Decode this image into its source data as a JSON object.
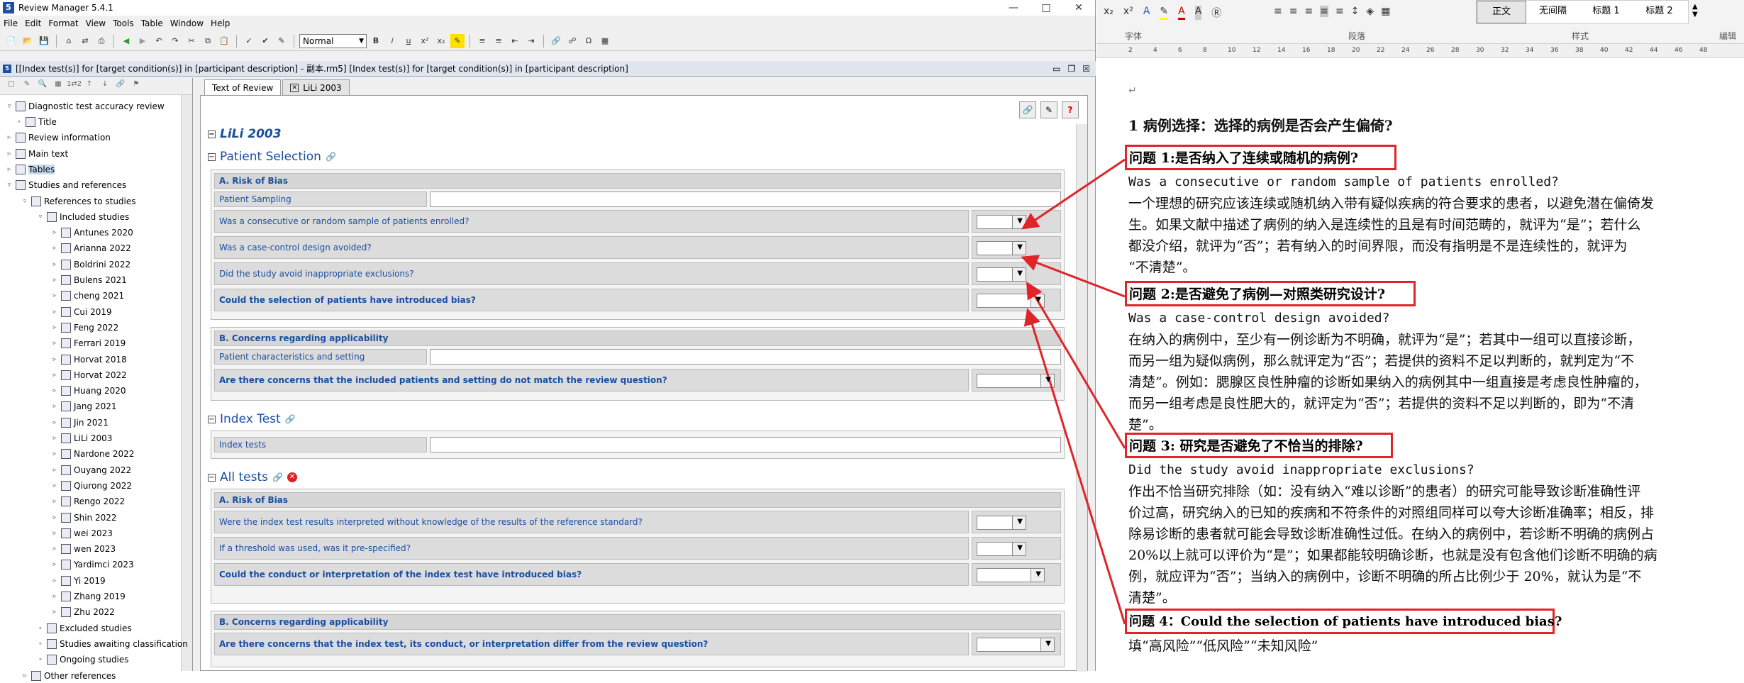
{
  "app": {
    "title": "Review Manager 5.4.1",
    "menu": [
      "File",
      "Edit",
      "Format",
      "View",
      "Tools",
      "Table",
      "Window",
      "Help"
    ],
    "style_select": "Normal",
    "doc_title": "[[Index test(s)] for [target condition(s)] in [participant description] - 副本.rm5] [Index test(s)] for [target condition(s)] in [participant description]"
  },
  "tree": {
    "root": "Diagnostic test accuracy review",
    "items": [
      "Title",
      "Review information",
      "Main text",
      "Tables",
      "Studies and references",
      "References to studies",
      "Included studies"
    ],
    "studies": [
      "Antunes 2020",
      "Arianna 2022",
      "Boldrini 2022",
      "Bulens 2021",
      "cheng 2021",
      "Cui 2019",
      "Feng 2022",
      "Ferrari 2019",
      "Horvat 2018",
      "Horvat 2022",
      "Huang 2020",
      "Jang 2021",
      "Jin 2021",
      "LiLi 2003",
      "Nardone 2022",
      "Ouyang 2022",
      "Qiurong 2022",
      "Rengo 2022",
      "Shin 2022",
      "wei 2023",
      "wen 2023",
      "Yardimci 2023",
      "Yi 2019",
      "Zhang 2019",
      "Zhu 2022"
    ],
    "tail": [
      "Excluded studies",
      "Studies awaiting classification",
      "Ongoing studies",
      "Other references"
    ]
  },
  "editor": {
    "tabs": [
      "Text of Review",
      "LiLi 2003"
    ],
    "study_title": "LiLi 2003",
    "patient_selection": {
      "heading": "Patient Selection",
      "risk_heading": "A. Risk of Bias",
      "sampling_label": "Patient Sampling",
      "q1": "Was a consecutive or random sample of patients enrolled?",
      "q2": "Was a case-control design avoided?",
      "q3": "Did the study avoid inappropriate exclusions?",
      "q4": "Could the selection of patients have introduced bias?",
      "concern_heading": "B. Concerns regarding applicability",
      "characteristics_label": "Patient characteristics and setting",
      "concern_q": "Are there concerns that the included patients and setting do not match the review question?"
    },
    "index_test": {
      "heading": "Index Test",
      "label": "Index tests"
    },
    "all_tests": {
      "heading": "All tests",
      "risk_heading": "A. Risk of Bias",
      "q1": "Were the index test results interpreted without knowledge of the results of the reference standard?",
      "q2": "If a threshold was used, was it pre-specified?",
      "q3": "Could the conduct or interpretation of the index test have introduced bias?",
      "concern_heading": "B. Concerns regarding applicability",
      "concern_q": "Are there concerns that the index test, its conduct, or interpretation differ from the review question?"
    }
  },
  "word": {
    "ribbon_groups": [
      "字体",
      "段落",
      "样式",
      "编辑"
    ],
    "styles": [
      "正文",
      "无间隔",
      "标题 1",
      "标题 2"
    ],
    "heading": "1  病例选择：选择的病例是否会产生偏倚?",
    "q1_title": "问题 1:是否纳入了连续或随机的病例?",
    "q1_en": "Was a consecutive or random sample of patients enrolled?",
    "q1_text": [
      "一个理想的研究应该连续或随机纳入带有疑似疾病的符合要求的患者，以避免潜在偏倚发",
      "生。如果文献中描述了病例的纳入是连续性的且是有时间范畴的，就评为“是”；若什么",
      "都没介绍，就评为“否”；若有纳入的时间界限，而没有指明是不是连续性的，就评为",
      "“不清楚”。"
    ],
    "q2_title": "问题 2:是否避免了病例—对照类研究设计?",
    "q2_en": "Was a case-control design avoided?",
    "q2_text": [
      "在纳入的病例中，至少有一例诊断为不明确，就评为“是”；若其中一组可以直接诊断，",
      "而另一组为疑似病例，那么就评定为“否”；若提供的资料不足以判断的，就判定为“不",
      "清楚”。例如：腮腺区良性肿瘤的诊断如果纳入的病例其中一组直接是考虑良性肿瘤的，",
      "而另一组考虑是良性肥大的，就评定为“否”；若提供的资料不足以判断的，即为“不清",
      "楚”。"
    ],
    "q3_title": "问题 3: 研究是否避免了不恰当的排除?",
    "q3_en": "Did the study avoid inappropriate exclusions?",
    "q3_text": [
      "作出不恰当研究排除（如：没有纳入“难以诊断”的患者）的研究可能导致诊断准确性评",
      "价过高，研究纳入的已知的疾病和不符条件的对照组同样可以夸大诊断准确率；相反，排",
      "除易诊断的患者就可能会导致诊断准确性过低。在纳入的病例中，若诊断不明确的病例占",
      "20%以上就可以评价为“是”；如果都能较明确诊断，也就是没有包含他们诊断不明确的病",
      "例，就应评为“否”；当纳入的病例中，诊断不明确的所占比例少于 20%，就认为是“不",
      "清楚”。"
    ],
    "q4_title": "问题 4：Could the selection of patients have introduced bias?",
    "q4_text": "填“高风险”“低风险”“未知风险”"
  },
  "colors": {
    "highlight": "#e0242a",
    "link_blue": "#1a4fa0"
  }
}
